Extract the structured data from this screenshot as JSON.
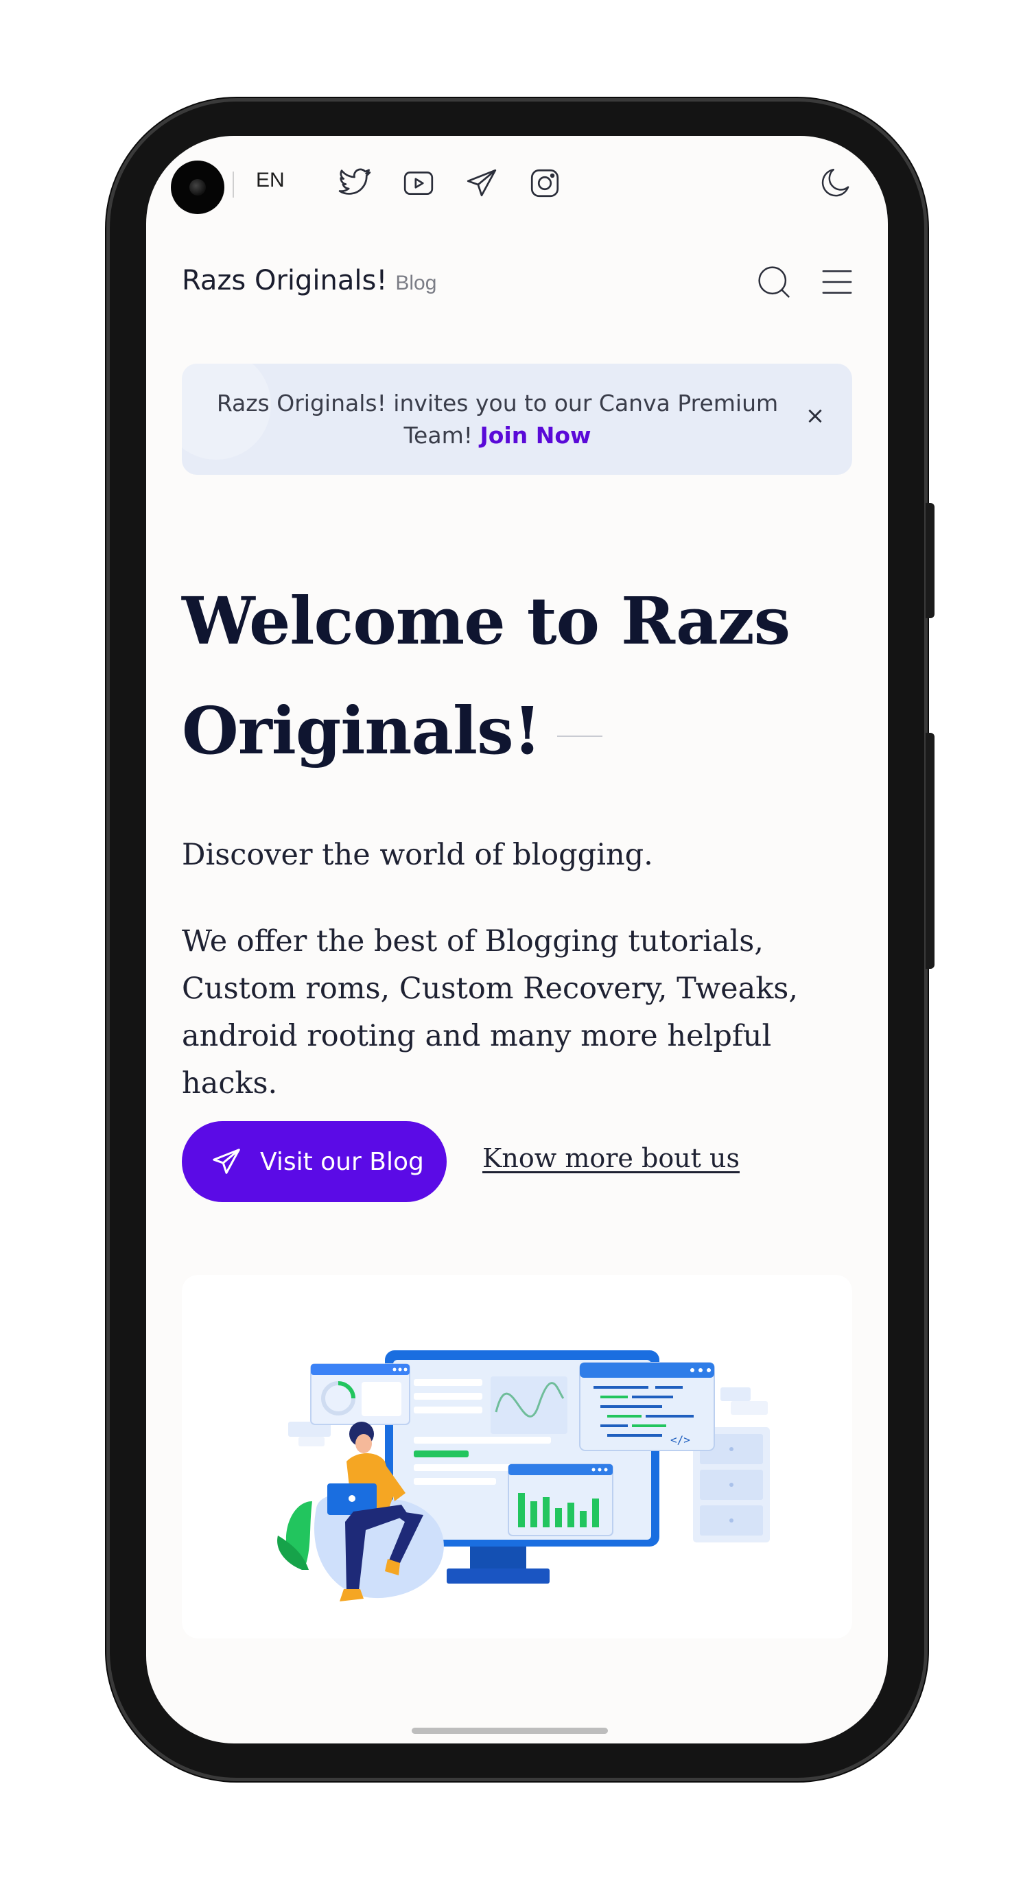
{
  "topbar": {
    "language": "EN",
    "social_icons": [
      "twitter-icon",
      "youtube-icon",
      "telegram-icon",
      "instagram-icon"
    ],
    "theme_icon": "moon-icon"
  },
  "header": {
    "title": "Razs Originals!",
    "subtitle": "Blog",
    "icons": [
      "search-icon",
      "menu-icon"
    ]
  },
  "announcement": {
    "text": "Razs Originals! invites you to our Canva Premium Team!",
    "link_label": "Join Now",
    "close_label": "×"
  },
  "hero": {
    "title": "Welcome to Razs Originals!",
    "lead": "Discover the world of blogging.",
    "description": "We offer the best of Blogging tutorials, Custom roms, Custom Recovery, Tweaks, android rooting and many more helpful hacks.",
    "primary_button": "Visit our Blog",
    "secondary_link": "Know more bout us"
  },
  "colors": {
    "accent": "#5b0be6",
    "link": "#5a0ad8",
    "heading": "#0f1530",
    "page_background": "#fcfbfa",
    "announce_background": "#e7ecf7"
  }
}
